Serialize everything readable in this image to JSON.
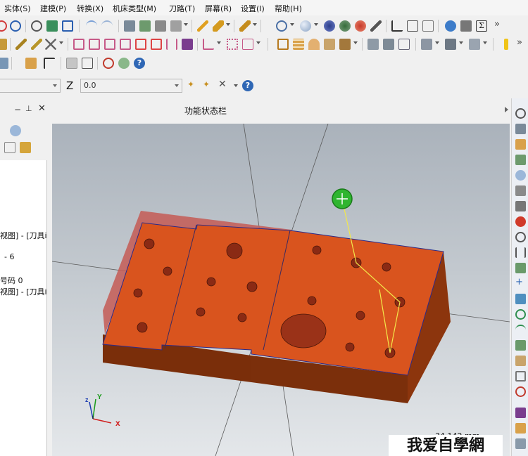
{
  "menubar": {
    "items": [
      "实体(S)",
      "建模(P)",
      "转换(X)",
      "机床类型(M)",
      "刀路(T)",
      "屏幕(R)",
      "设置(I)",
      "帮助(H)"
    ]
  },
  "inputbar": {
    "first_combo_value": "",
    "z_label": "Z",
    "z_value": "0.0"
  },
  "left_panel": {
    "lines": [
      "视图] - [刀具i",
      "- 6",
      "号码 0",
      "视图] - [刀具i"
    ]
  },
  "viewport": {
    "title": "功能状态栏",
    "axis_x_label": "x",
    "axis_y_label": "Y",
    "axis_z_label": "z",
    "scale_readout": "34.142 mm"
  },
  "watermark": {
    "text": "我爱自學網"
  },
  "colors": {
    "part_face": "#d9541e",
    "part_side": "#7a2e0a",
    "stock_shadow": "#c45a55",
    "toolpath": "#f2e84a",
    "tool_marker": "#2fb52f"
  }
}
